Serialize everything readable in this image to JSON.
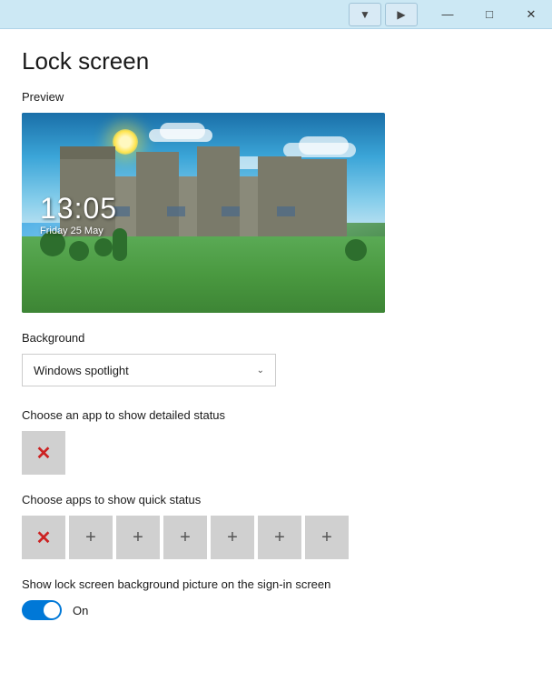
{
  "titlebar": {
    "filter_icon": "▼",
    "pin_icon": "▶",
    "minimize_label": "—",
    "maximize_label": "□",
    "close_label": "✕"
  },
  "page": {
    "title": "Lock screen",
    "preview_label": "Preview",
    "preview_time": "13:05",
    "preview_date": "Friday 25 May",
    "background_label": "Background",
    "background_value": "Windows spotlight",
    "background_dropdown_arrow": "⌄",
    "detailed_status_label": "Choose an app to show detailed status",
    "quick_status_label": "Choose apps to show quick status",
    "signin_label": "Show lock screen background picture on the sign-in screen",
    "on_label": "On"
  },
  "quick_status_buttons": [
    {
      "type": "remove",
      "symbol": "✕"
    },
    {
      "type": "add",
      "symbol": "+"
    },
    {
      "type": "add",
      "symbol": "+"
    },
    {
      "type": "add",
      "symbol": "+"
    },
    {
      "type": "add",
      "symbol": "+"
    },
    {
      "type": "add",
      "symbol": "+"
    },
    {
      "type": "add",
      "symbol": "+"
    }
  ]
}
